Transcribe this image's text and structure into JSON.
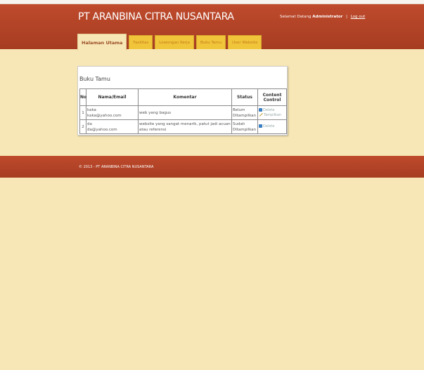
{
  "header": {
    "site_title": "PT ARANBINA CITRA NUSANTARA",
    "welcome_prefix": "Selamat Datang",
    "username": "Administrator",
    "separator": "|",
    "logout_label": "Log out"
  },
  "tabs": [
    {
      "label": "Halaman Utama",
      "active": true
    },
    {
      "label": "Fasilitas",
      "active": false
    },
    {
      "label": "Lowongan Kerja",
      "active": false
    },
    {
      "label": "Buku Tamu",
      "active": false
    },
    {
      "label": "User Website",
      "active": false
    }
  ],
  "panel": {
    "title": "Buku Tamu",
    "columns": [
      "No",
      "Nama/Email",
      "Komentar",
      "Status",
      "Content Control"
    ],
    "rows": [
      {
        "no": "1",
        "name": "kaka",
        "email": "kaka@yahoo.com",
        "comment": "web yang bagus",
        "status": "Belum Ditampilkan",
        "actions": [
          "Delete",
          "Tampilkan"
        ]
      },
      {
        "no": "2",
        "name": "da",
        "email": "da@yahoo.com",
        "comment": "website yang sangat menarik, patut jadi acuan atau referensi",
        "status": "Sudah Ditampilkan",
        "actions": [
          "Delete"
        ]
      }
    ]
  },
  "footer": {
    "text": "© 2013 - PT ARANBINA CITRA NUSANTARA"
  },
  "icons": {
    "delete": "delete-icon",
    "show": "pencil-icon"
  },
  "colors": {
    "header_bg": "#b84428",
    "page_bg": "#f7e7b6",
    "tab_bg": "#f0c53a"
  }
}
